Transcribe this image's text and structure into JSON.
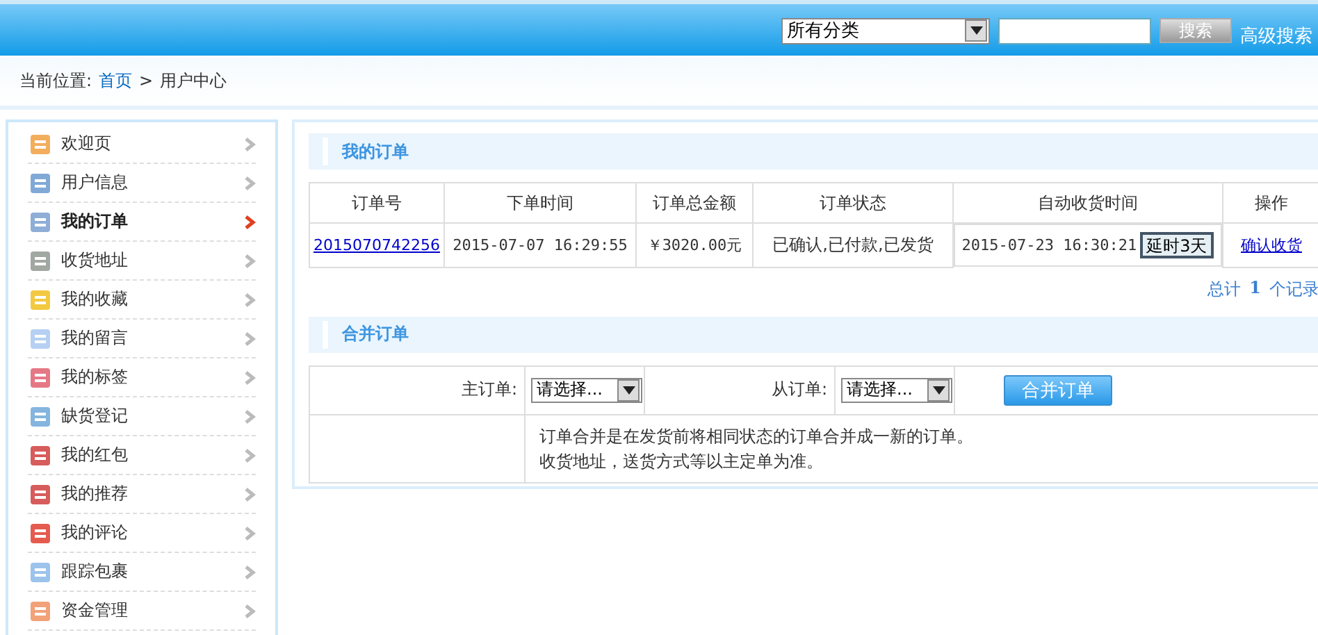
{
  "header": {
    "category_select": "所有分类",
    "search_button": "搜索",
    "advanced_search": "高级搜索"
  },
  "breadcrumb": {
    "label": "当前位置:",
    "links": [
      "首页"
    ],
    "separator": ">",
    "current": "用户中心"
  },
  "sidebar": {
    "items": [
      {
        "label": "欢迎页",
        "selected": false
      },
      {
        "label": "用户信息",
        "selected": false
      },
      {
        "label": "我的订单",
        "selected": true
      },
      {
        "label": "收货地址",
        "selected": false
      },
      {
        "label": "我的收藏",
        "selected": false
      },
      {
        "label": "我的留言",
        "selected": false
      },
      {
        "label": "我的标签",
        "selected": false
      },
      {
        "label": "缺货登记",
        "selected": false
      },
      {
        "label": "我的红包",
        "selected": false
      },
      {
        "label": "我的推荐",
        "selected": false
      },
      {
        "label": "我的评论",
        "selected": false
      },
      {
        "label": "跟踪包裹",
        "selected": false
      },
      {
        "label": "资金管理",
        "selected": false
      }
    ]
  },
  "orders": {
    "title": "我的订单",
    "columns": [
      "订单号",
      "下单时间",
      "订单总金额",
      "订单状态",
      "自动收货时间",
      "操作"
    ],
    "rows": [
      {
        "order_no": "2015070742256",
        "order_time": "2015-07-07 16:29:55",
        "total": "￥3020.00元",
        "status": "已确认,已付款,已发货",
        "auto_receive_time": "2015-07-23 16:30:21",
        "delay_button": "延时3天",
        "action": "确认收货"
      }
    ],
    "summary": {
      "prefix": "总计",
      "count": "1",
      "suffix": "个记录"
    }
  },
  "merge": {
    "title": "合并订单",
    "main_label": "主订单:",
    "main_select": "请选择...",
    "sub_label": "从订单:",
    "sub_select": "请选择...",
    "button": "合并订单",
    "notes": [
      "订单合并是在发货前将相同状态的订单合并成一新的订单。",
      "收货地址，送货方式等以主定单为准。"
    ]
  }
}
